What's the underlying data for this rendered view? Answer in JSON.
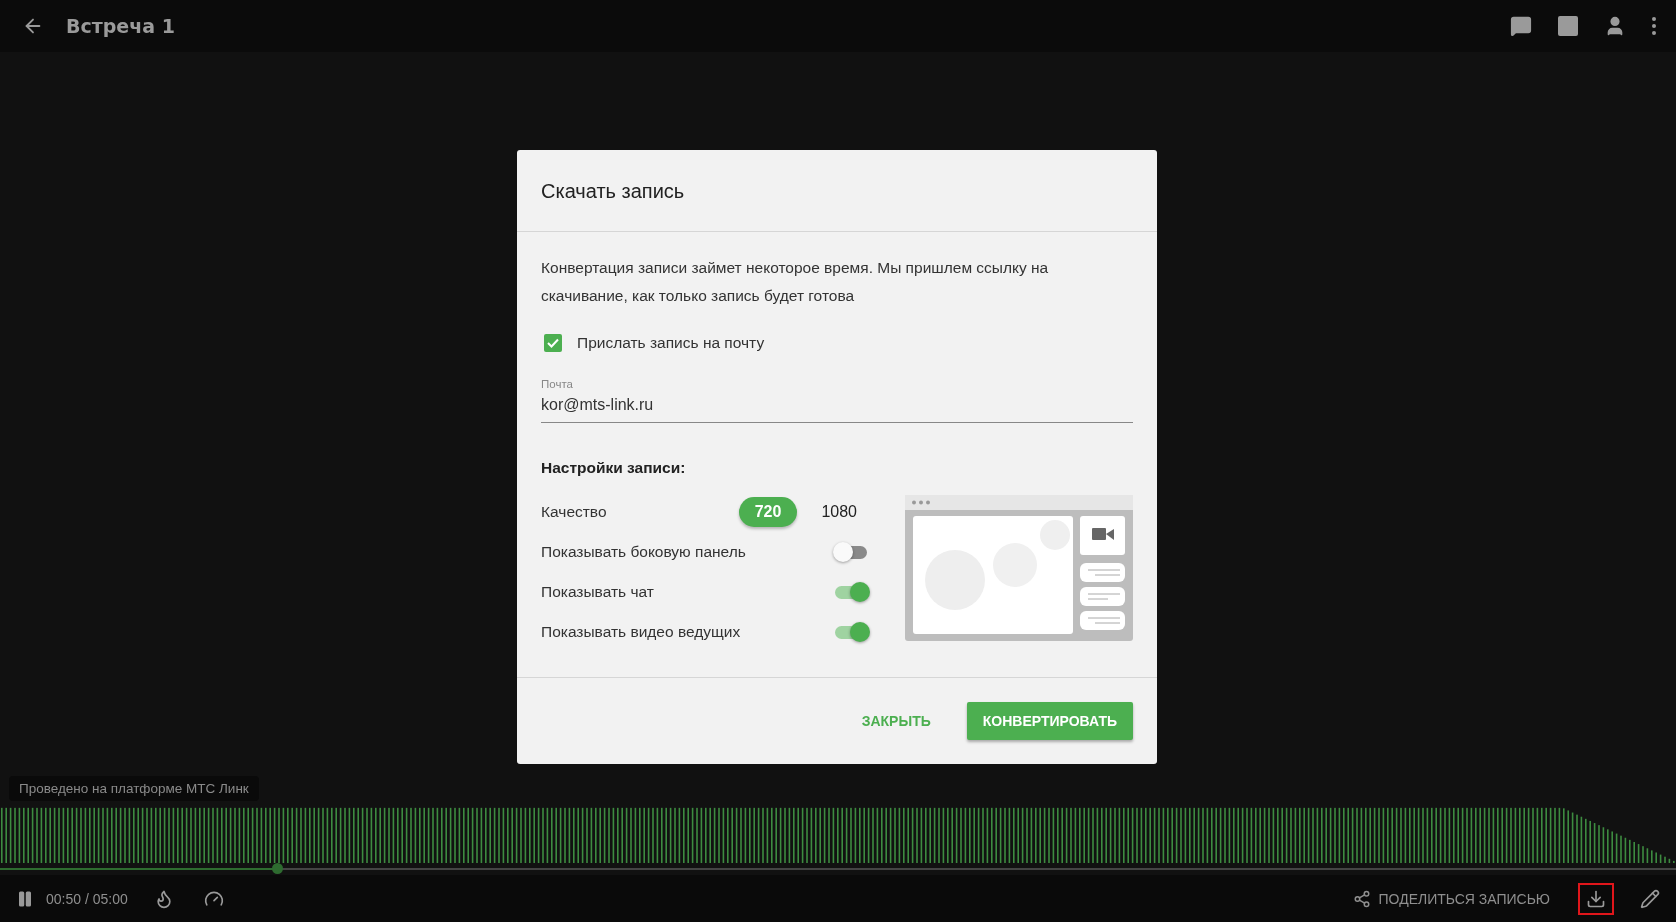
{
  "header": {
    "title": "Встреча 1"
  },
  "dialog": {
    "title": "Скачать запись",
    "description": "Конвертация записи займет некоторое время. Мы пришлем ссылку на скачивание, как только запись будет готова",
    "email_checkbox": {
      "label": "Прислать запись на почту",
      "checked": true
    },
    "email_field": {
      "label": "Почта",
      "value": "kor@mts-link.ru"
    },
    "settings_title": "Настройки записи:",
    "quality": {
      "label": "Качество",
      "options": [
        {
          "label": "720",
          "selected": true
        },
        {
          "label": "1080",
          "selected": false
        }
      ]
    },
    "toggles": [
      {
        "label": "Показывать боковую панель",
        "on": false
      },
      {
        "label": "Показывать чат",
        "on": true
      },
      {
        "label": "Показывать видео ведущих",
        "on": true
      }
    ],
    "buttons": {
      "close": "ЗАКРЫТЬ",
      "convert": "КОНВЕРТИРОВАТЬ"
    }
  },
  "watermark_label": "Проведено на платформе МТС Линк",
  "player": {
    "progress": {
      "level": 0.165
    },
    "time": "00:50 / 05:00",
    "share": "ПОДЕЛИТЬСЯ ЗАПИСЬЮ",
    "download_highlighted": true
  }
}
